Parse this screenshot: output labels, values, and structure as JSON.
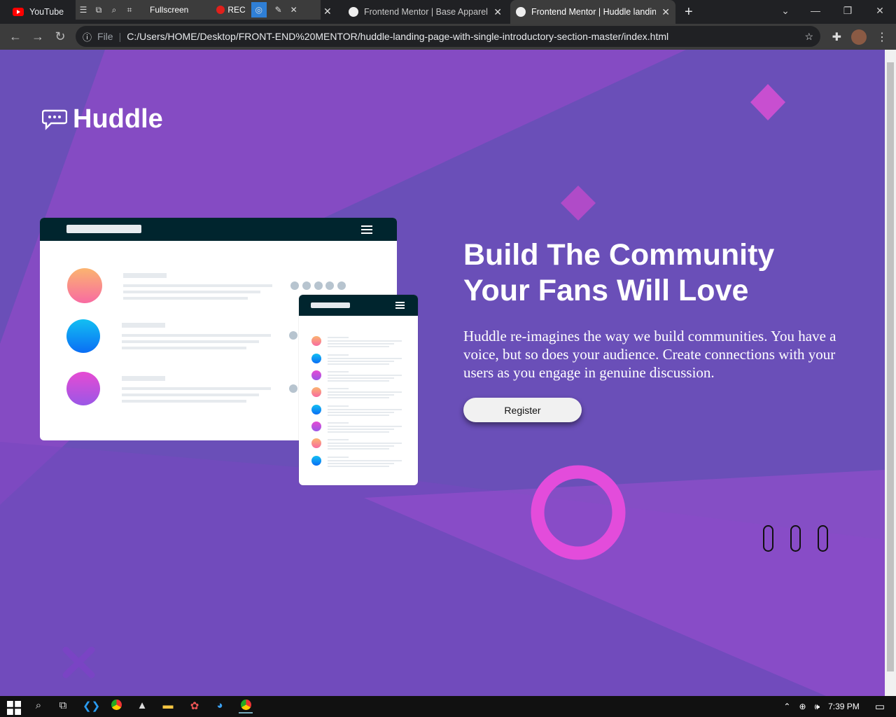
{
  "browser": {
    "tabs": [
      {
        "title": "YouTube"
      },
      {
        "title": "Frontend Mentor | Base Apparel c"
      },
      {
        "title": "Frontend Mentor | Huddle landin",
        "active": true
      }
    ],
    "recorder": {
      "fullscreen_label": "Fullscreen",
      "rec_label": "REC"
    },
    "address": {
      "scheme_label": "File",
      "url": "C:/Users/HOME/Desktop/FRONT-END%20MENTOR/huddle-landing-page-with-single-introductory-section-master/index.html"
    }
  },
  "page": {
    "brand": "Huddle",
    "headline_line1": "Build The Community",
    "headline_line2": "Your Fans Will Love",
    "description": "Huddle re-imagines the way we build communities. You have a voice, but so does your audience. Create connections with your users as you engage in genuine discussion.",
    "cta_label": "Register"
  },
  "taskbar": {
    "clock": "7:39 PM"
  },
  "colors": {
    "background": "#6a4fb8",
    "accent_pink": "#e94ad9",
    "mock_header": "#00252e"
  }
}
